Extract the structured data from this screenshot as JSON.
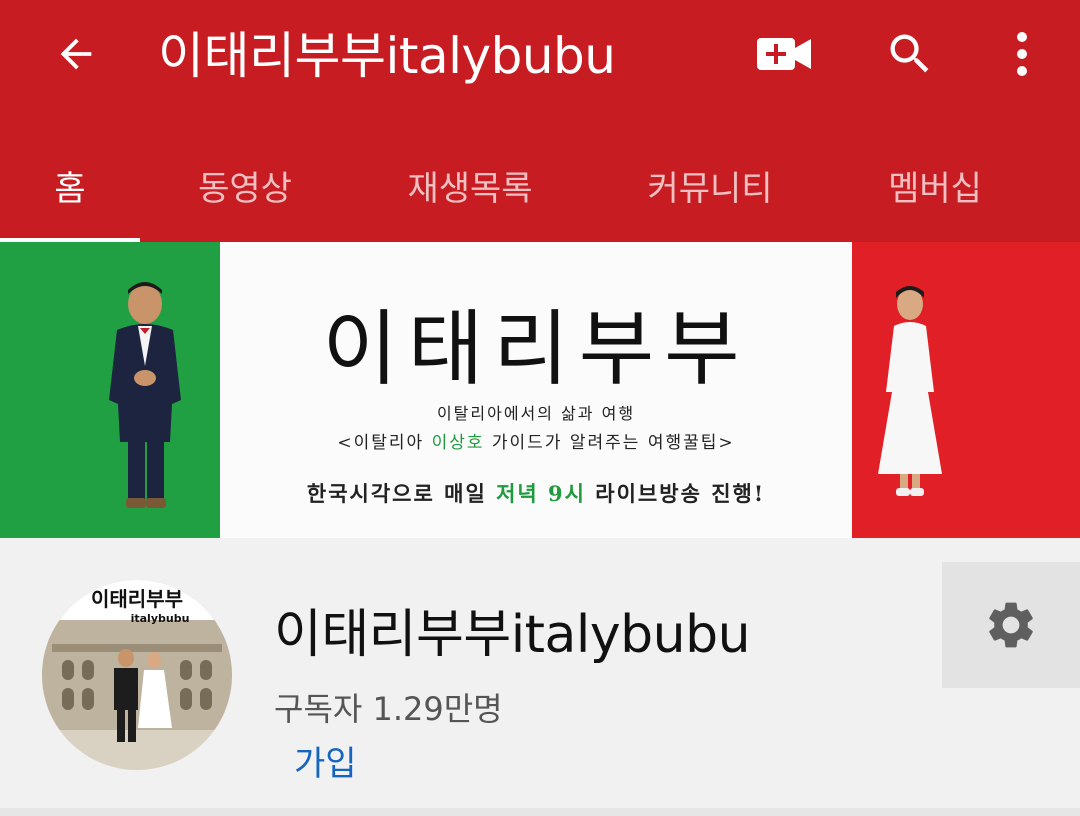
{
  "appbar": {
    "title": "이태리부부italybubu",
    "back_icon": "arrow-left-icon",
    "actions": [
      "video-add-icon",
      "search-icon",
      "more-vert-icon"
    ],
    "color": "#c61c22"
  },
  "tabs": [
    {
      "label": "홈",
      "active": true
    },
    {
      "label": "동영상",
      "active": false
    },
    {
      "label": "재생목록",
      "active": false
    },
    {
      "label": "커뮤니티",
      "active": false
    },
    {
      "label": "멤버십",
      "active": false
    }
  ],
  "banner": {
    "title": "이태리부부",
    "line1": "이탈리아에서의 삶과 여행",
    "line2_pre": "<이탈리아 ",
    "line2_hl": "이상호",
    "line2_post": " 가이드가 알려주는 여행꿀팁>",
    "line3_pre": "한국시각으로 매일 ",
    "line3_hl": "저녁 9시",
    "line3_post": " 라이브방송 진행!",
    "colors": {
      "green": "#20a043",
      "white": "#fbfbfb",
      "red": "#e01f26"
    }
  },
  "channel": {
    "avatar_title": "이태리부부",
    "avatar_sub": "italybubu",
    "name": "이태리부부italybubu",
    "subscribers": "구독자 1.29만명",
    "join_label": "가입",
    "settings_icon": "gear-icon",
    "join_color": "#1565c0"
  }
}
